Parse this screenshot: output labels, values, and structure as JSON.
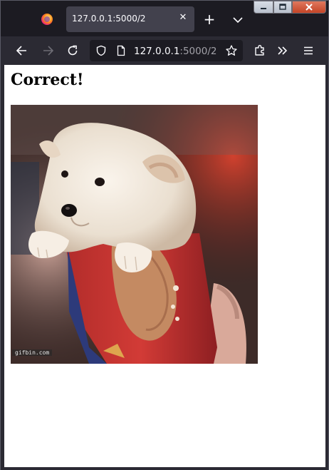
{
  "browser": {
    "tab": {
      "title": "127.0.0.1:5000/2",
      "close_glyph": "✕"
    },
    "new_tab_glyph": "+",
    "url": {
      "host": "127.0.0.1",
      "path": ":5000/2"
    },
    "icons": {
      "back": "back-arrow-icon",
      "forward": "forward-arrow-icon",
      "reload": "reload-icon",
      "shield": "tracking-protection-shield-icon",
      "page": "page-info-icon",
      "bookmark": "bookmark-star-icon",
      "extensions": "extensions-icon",
      "overflow": "overflow-chevrons-icon",
      "menu": "hamburger-menu-icon"
    }
  },
  "page": {
    "heading": "Correct!",
    "image": {
      "subject": "puppy",
      "watermark": "gifbin.com"
    }
  },
  "colors": {
    "toolbar": "#2b2a33",
    "tabstrip": "#1c1b22",
    "active_tab": "#42414d",
    "urlbar": "#1c1b22",
    "page_bg": "#ffffff"
  }
}
